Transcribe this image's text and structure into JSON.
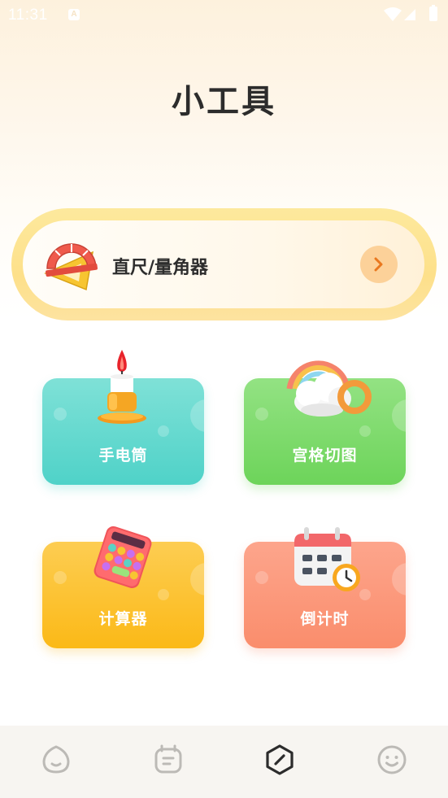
{
  "status_bar": {
    "time": "11:31",
    "notification_icon": "a-letter-icon",
    "icons": [
      "wifi-icon",
      "signal-icon",
      "battery-icon"
    ]
  },
  "page": {
    "title": "小工具"
  },
  "featured_tool": {
    "label": "直尺/量角器",
    "icon": "ruler-protractor-icon",
    "action_icon": "chevron-right-icon",
    "colors": {
      "border": "#fde08a",
      "arrow_bg": "#fcd199",
      "arrow_fg": "#e9781f"
    }
  },
  "tools": [
    {
      "label": "手电筒",
      "icon": "candle-flashlight-icon",
      "color": "#4fd2c8"
    },
    {
      "label": "宫格切图",
      "icon": "rainbow-cloud-icon",
      "color": "#6dd45a"
    },
    {
      "label": "计算器",
      "icon": "calculator-icon",
      "color": "#fbb917"
    },
    {
      "label": "倒计时",
      "icon": "calendar-clock-icon",
      "color": "#fa8d6c"
    }
  ],
  "bottom_nav": {
    "items": [
      {
        "icon": "home-face-icon",
        "active": false
      },
      {
        "icon": "notes-icon",
        "active": false
      },
      {
        "icon": "compass-tools-icon",
        "active": true
      },
      {
        "icon": "smiley-profile-icon",
        "active": false
      }
    ],
    "colors": {
      "active": "#2c2c2c",
      "inactive": "#bcbab6"
    }
  }
}
